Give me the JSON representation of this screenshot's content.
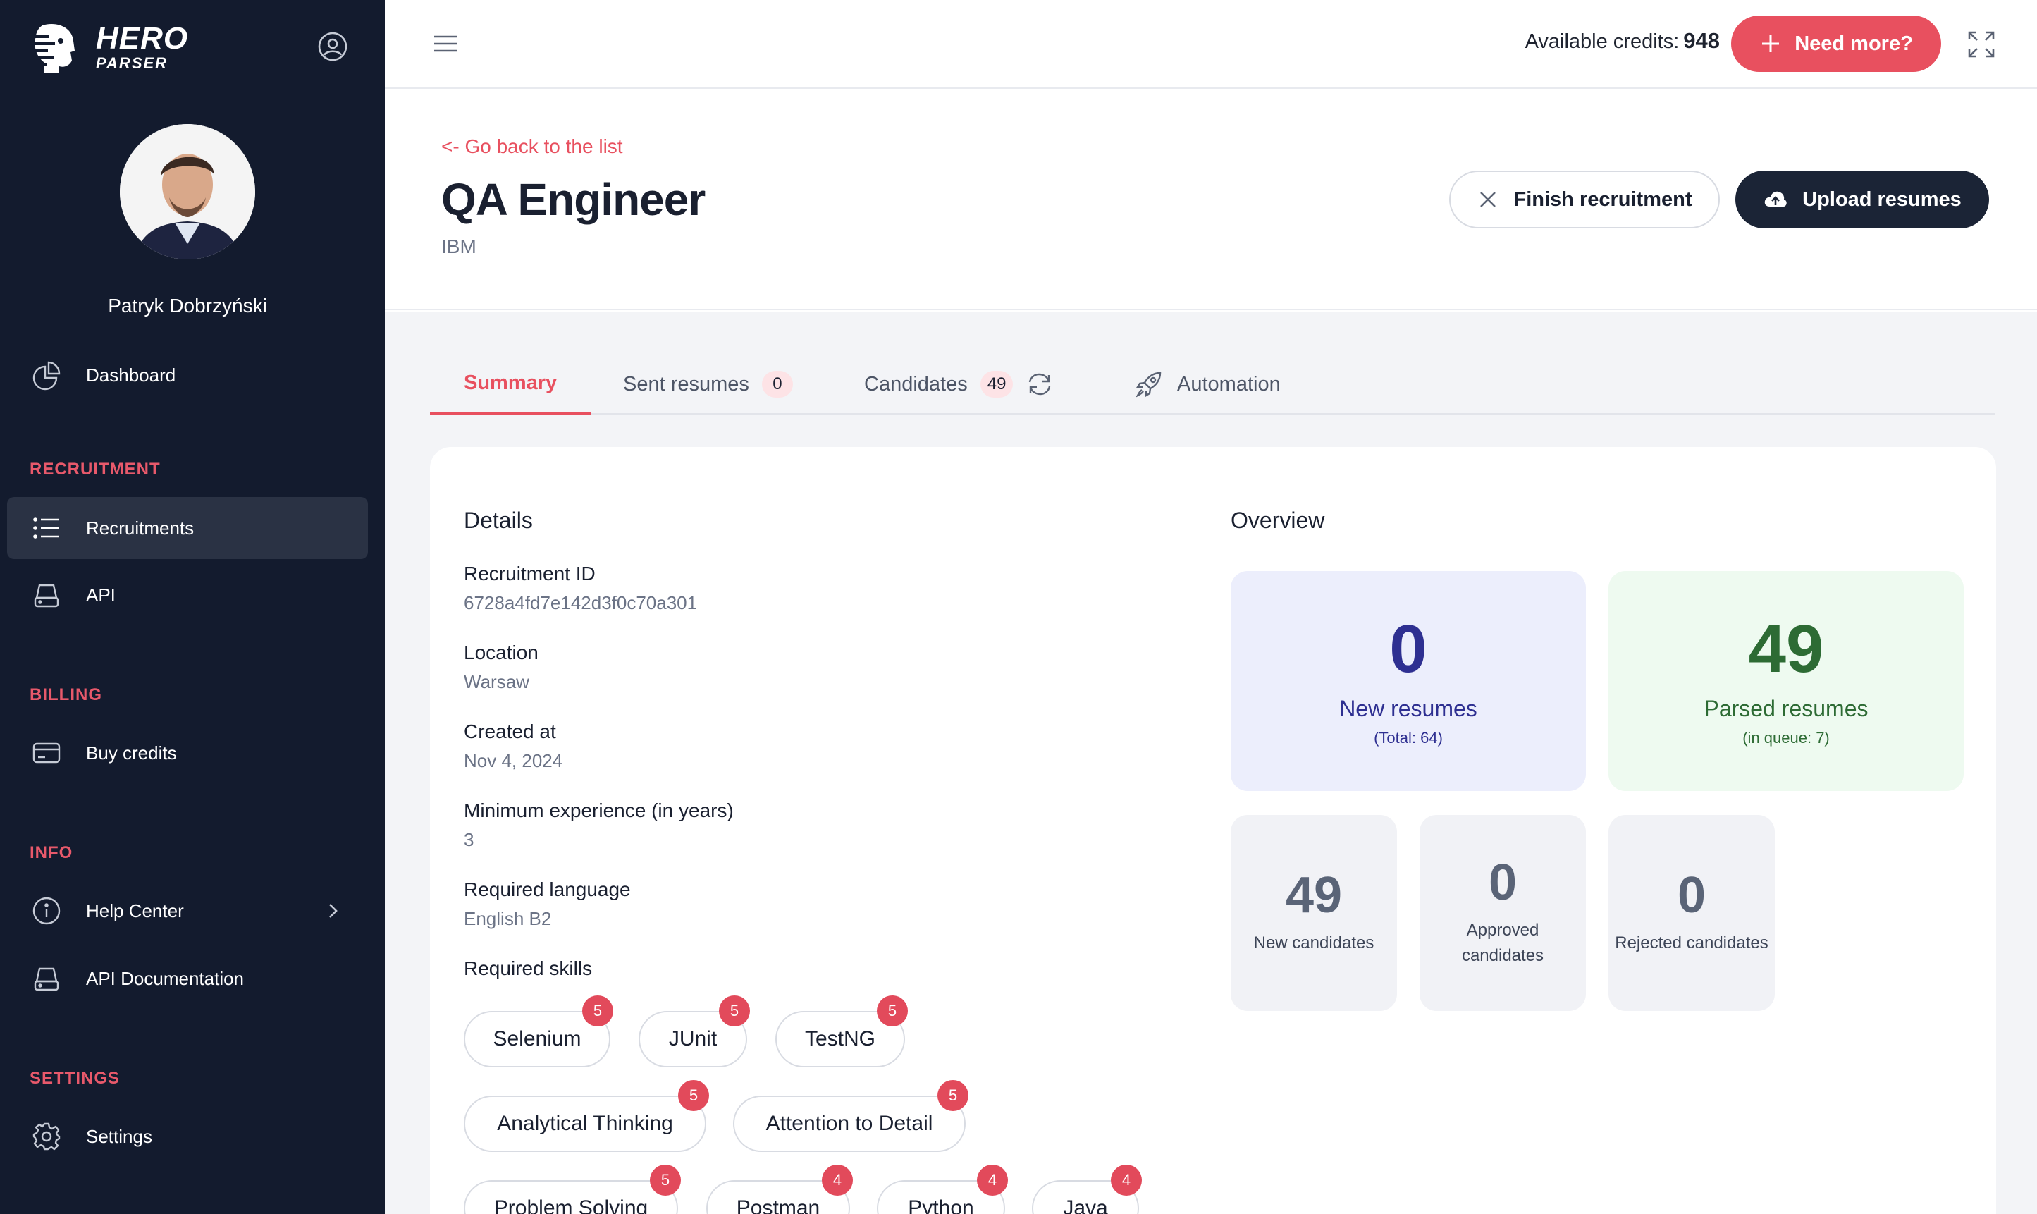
{
  "sidebar": {
    "logo": {
      "line1": "HERO",
      "line2": "PARSER"
    },
    "user_name": "Patryk Dobrzyński",
    "dashboard": "Dashboard",
    "sections": {
      "recruitment": "RECRUITMENT",
      "billing": "BILLING",
      "info": "INFO",
      "settings": "SETTINGS"
    },
    "items": {
      "recruitments": "Recruitments",
      "api": "API",
      "buy_credits": "Buy credits",
      "help_center": "Help Center",
      "api_documentation": "API Documentation",
      "settings": "Settings"
    }
  },
  "topbar": {
    "credits_label": "Available credits:",
    "credits_value": "948",
    "need_more": "Need more?"
  },
  "header": {
    "back_link": "<- Go back to the list",
    "title": "QA Engineer",
    "company": "IBM",
    "finish_button": "Finish recruitment",
    "upload_button": "Upload resumes"
  },
  "tabs": {
    "summary": "Summary",
    "sent_resumes": "Sent resumes",
    "sent_resumes_count": "0",
    "candidates": "Candidates",
    "candidates_count": "49",
    "automation": "Automation"
  },
  "details": {
    "title": "Details",
    "recruitment_id_label": "Recruitment ID",
    "recruitment_id": "6728a4fd7e142d3f0c70a301",
    "location_label": "Location",
    "location": "Warsaw",
    "created_label": "Created at",
    "created": "Nov 4, 2024",
    "min_exp_label": "Minimum experience (in years)",
    "min_exp": "3",
    "language_label": "Required language",
    "language": "English B2",
    "skills_label": "Required skills",
    "skills": [
      {
        "name": "Selenium",
        "level": "5"
      },
      {
        "name": "JUnit",
        "level": "5"
      },
      {
        "name": "TestNG",
        "level": "5"
      },
      {
        "name": "Analytical Thinking",
        "level": "5"
      },
      {
        "name": "Attention to Detail",
        "level": "5"
      },
      {
        "name": "Problem Solving",
        "level": "5"
      },
      {
        "name": "Postman",
        "level": "4"
      },
      {
        "name": "Python",
        "level": "4"
      },
      {
        "name": "Java",
        "level": "4"
      }
    ]
  },
  "overview": {
    "title": "Overview",
    "new_resumes": {
      "value": "0",
      "label": "New resumes",
      "sub": "(Total: 64)"
    },
    "parsed_resumes": {
      "value": "49",
      "label": "Parsed resumes",
      "sub": "(in queue: 7)"
    },
    "new_candidates": {
      "value": "49",
      "label": "New candidates"
    },
    "approved_candidates": {
      "value": "0",
      "label1": "Approved",
      "label2": "candidates"
    },
    "rejected_candidates": {
      "value": "0",
      "label": "Rejected candidates"
    }
  },
  "colors": {
    "sidebar_bg": "#131b2e",
    "accent": "#e8505f",
    "new_resumes_bg": "#eceefc",
    "new_resumes_text": "#2e2f91",
    "parsed_bg": "#eefaf0",
    "parsed_text": "#2d6b34"
  }
}
